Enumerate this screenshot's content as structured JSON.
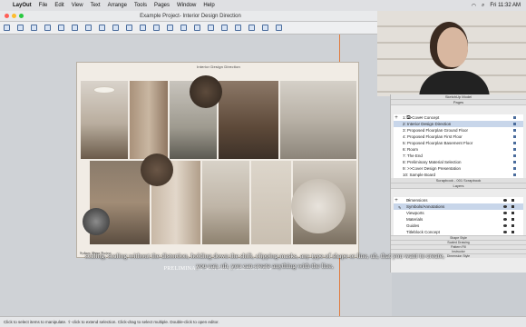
{
  "menubar": {
    "apple": "",
    "items": [
      "LayOut",
      "File",
      "Edit",
      "View",
      "Text",
      "Arrange",
      "Tools",
      "Pages",
      "Window",
      "Help"
    ],
    "clock": "Fri 11:32 AM"
  },
  "window": {
    "title": "Example Project- Interior Design Direction"
  },
  "document": {
    "page_title": "Interior Design Direction",
    "footer_label": "Sydney Shore   Project",
    "below_page_label": "PRELIMINARY MATERIAL SELECTIONS"
  },
  "caption": "scaling, scaling without the distortion, holding down the shift, clipping masks, any type of shape or line, uh, that you want to create, you can, uh, you can create anything with the line,",
  "statusbar": {
    "text": "Click to select items to manipulate. ⇧-click to extend selection. Click-drag to select multiple. Double-click to open editor."
  },
  "panels": {
    "sketchup_title": "SketchUp Model",
    "pages_title": "Pages",
    "pages": [
      "1:  >>Cover Concept",
      "2:  Interior Design Direction",
      "3:  Proposed Floorplan Ground Floor",
      "4:  Proposed Floorplan First Floor",
      "5:  Proposed Floorplan Basement Floor",
      "6:  Room",
      "7:  The End",
      "8:  Preliminary Material Selection",
      "9:  >>Cover Design Presentation",
      "10:  Sample Board"
    ],
    "scrapbook_title": "Scrapbook - 001 Scrapbook",
    "layers_title": "Layers",
    "layers": [
      "Dimensions",
      "Symbols/Annotations",
      "Viewports",
      "Materials",
      "Guides",
      "Titleblock Concept"
    ],
    "strips": [
      "Shape Style",
      "Scaled Drawing",
      "Pattern Fill",
      "Instructor",
      "Dimension Style"
    ]
  },
  "colors": {
    "guide": "#e07a3d",
    "selection": "#c8d6ea",
    "accent": "#4a6c9c"
  }
}
